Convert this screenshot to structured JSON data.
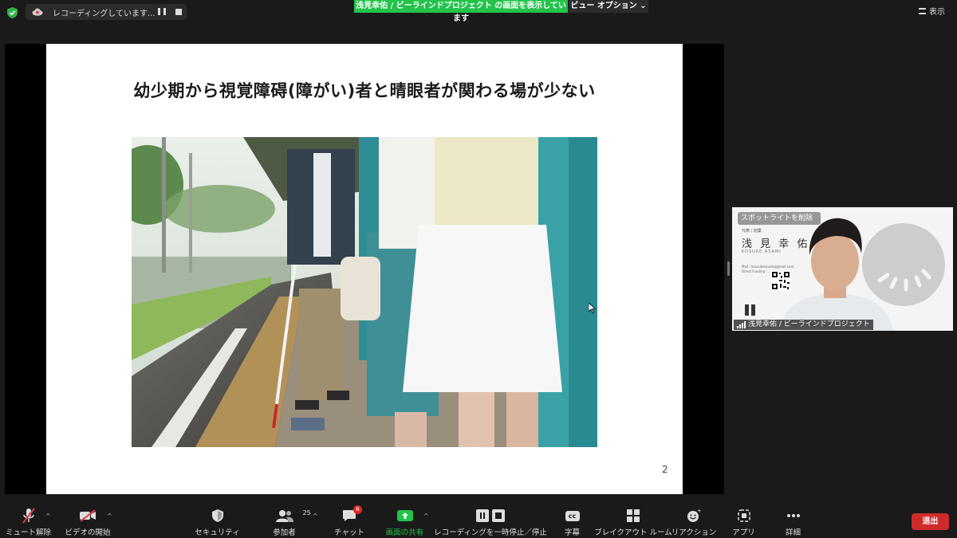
{
  "top_bar": {
    "recording_status": "レコーディングしています...",
    "share_banner": "浅見幸佑 / ビーラインドプロジェクト の画面を表示しています",
    "view_options": "ビュー オプション ⌄",
    "display_label": "表示"
  },
  "slide": {
    "title": "幼少期から視覚障碍(障がい)者と晴眼者が関わる場が少ない",
    "page_number": "2"
  },
  "participant_video": {
    "banner": "スポットライトを削除",
    "card_name": "浅 見 幸 佑",
    "card_role": "代表 / 創業",
    "card_romaji": "KOSUKE ASAMI",
    "card_contact": "Mail : kousukeasami@gmail.com\nDirect Funding : ...",
    "name_label": "浅見幸佑 / ビーラインドプロジェクト"
  },
  "toolbar": {
    "unmute": "ミュート解除",
    "start_video": "ビデオの開始",
    "security": "セキュリティ",
    "participants": "参加者",
    "participants_count": "25",
    "chat": "チャット",
    "chat_badge": "6",
    "share_screen": "画面の共有",
    "recording_control": "レコーディングを一時停止／停止",
    "captions": "字幕",
    "captions_icon": "cc",
    "breakout_rooms": "ブレイクアウト ルーム",
    "reactions": "リアクション",
    "apps": "アプリ",
    "more": "詳細",
    "leave": "退出"
  },
  "colors": {
    "share_green": "#23c34a",
    "leave_red": "#cf2b2b",
    "chat_badge_red": "#e02828",
    "toolbar_bg": "#1a1a1a"
  }
}
